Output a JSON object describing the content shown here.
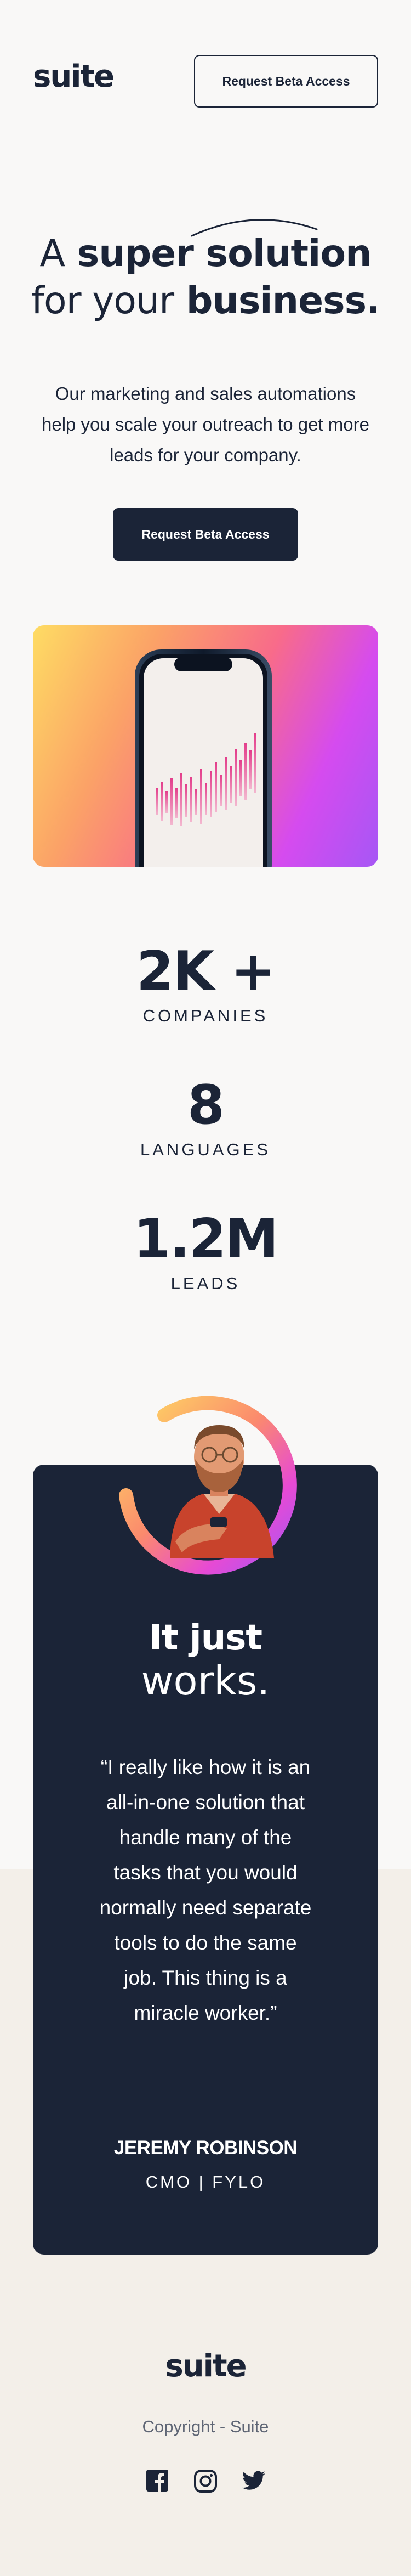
{
  "header": {
    "logo": "suite",
    "cta_label": "Request Beta Access"
  },
  "hero": {
    "title_line1_light": "A",
    "title_line1_bold": "super solution",
    "title_line2_light": "for your",
    "title_line2_bold": "business.",
    "description": "Our marketing and sales automations help you scale your outreach to get more leads for your company.",
    "cta_label": "Request Beta Access"
  },
  "stats": [
    {
      "value": "2K +",
      "label": "COMPANIES"
    },
    {
      "value": "8",
      "label": "LANGUAGES"
    },
    {
      "value": "1.2M",
      "label": "LEADS"
    }
  ],
  "testimonial": {
    "title_bold": "It just",
    "title_light": "works.",
    "quote": "“I really like how it is an all-in-one solution that handle many of the tasks that you would normally need separate tools to do the same job. This thing is a miracle worker.”",
    "author": "JEREMY ROBINSON",
    "role": "CMO | FYLO"
  },
  "footer": {
    "logo": "suite",
    "copyright": "Copyright - Suite",
    "social_icons": [
      "facebook-icon",
      "instagram-icon",
      "twitter-icon"
    ]
  },
  "colors": {
    "navy": "#1b2437",
    "background": "#f9f8f7",
    "footer_background": "#f3efe9",
    "gradient_yellow": "#fedc63",
    "gradient_pink": "#f86b8a",
    "gradient_purple": "#a657f5"
  }
}
